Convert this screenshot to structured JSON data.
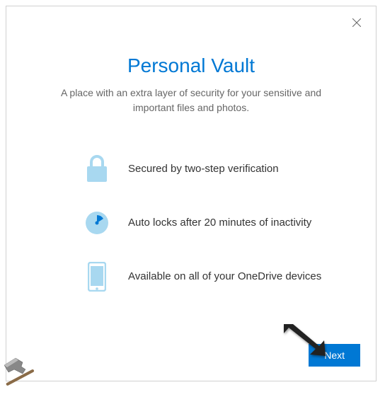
{
  "dialog": {
    "title": "Personal Vault",
    "subtitle": "A place with an extra layer of security for your sensitive and important files and photos.",
    "features": [
      {
        "icon": "lock-icon",
        "text": "Secured by two-step verification"
      },
      {
        "icon": "clock-icon",
        "text": "Auto locks after 20 minutes of inactivity"
      },
      {
        "icon": "phone-icon",
        "text": "Available on all of your OneDrive devices"
      }
    ],
    "next_label": "Next"
  },
  "colors": {
    "accent": "#0078d4",
    "icon_light": "#a8d8f0"
  }
}
